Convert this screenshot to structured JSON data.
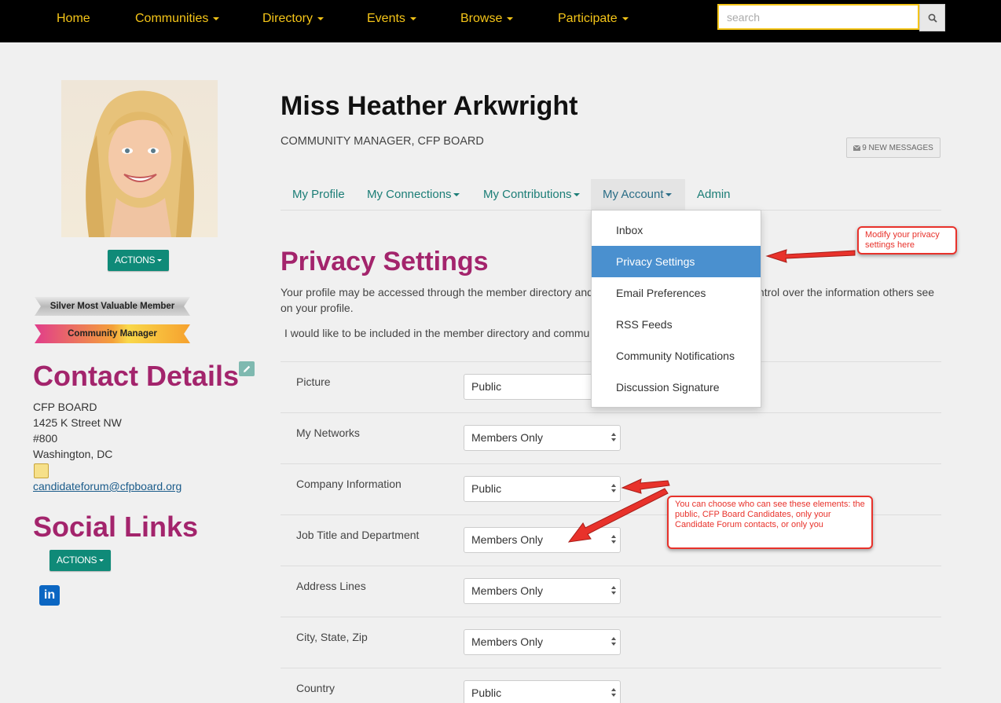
{
  "nav": {
    "items": [
      {
        "label": "Home",
        "has_caret": false
      },
      {
        "label": "Communities",
        "has_caret": true
      },
      {
        "label": "Directory",
        "has_caret": true
      },
      {
        "label": "Events",
        "has_caret": true
      },
      {
        "label": "Browse",
        "has_caret": true
      },
      {
        "label": "Participate",
        "has_caret": true
      }
    ],
    "search_placeholder": "search",
    "accent": "#f5c518"
  },
  "sidebar": {
    "actions_label": "ACTIONS",
    "badges": [
      "Silver Most Valuable Member",
      "Community Manager"
    ],
    "contact_heading": "Contact Details",
    "contact_lines": [
      "CFP BOARD",
      "1425 K Street NW",
      "#800",
      "Washington, DC"
    ],
    "email": "candidateforum@cfpboard.org",
    "social_heading": "Social Links",
    "social_actions_label": "ACTIONS",
    "linkedin_label": "in"
  },
  "profile": {
    "name": "Miss Heather Arkwright",
    "title": "COMMUNITY MANAGER, CFP BOARD",
    "messages_label": "9 NEW MESSAGES"
  },
  "tabs": [
    {
      "label": "My Profile",
      "has_caret": false
    },
    {
      "label": "My Connections",
      "has_caret": true
    },
    {
      "label": "My Contributions",
      "has_caret": true
    },
    {
      "label": "My Account",
      "has_caret": true
    },
    {
      "label": "Admin",
      "has_caret": false
    }
  ],
  "account_menu": [
    "Inbox",
    "Privacy Settings",
    "Email Preferences",
    "RSS Feeds",
    "Community Notifications",
    "Discussion Signature"
  ],
  "privacy": {
    "heading": "Privacy Settings",
    "intro_part1": "Your profile may be accessed through the member directory and",
    "intro_part2": "ntrol over the information others see",
    "intro_part3": "on your profile.",
    "include_text": "I would like to be included in the member directory and commu",
    "rows": [
      {
        "label": "Picture",
        "value": "Public"
      },
      {
        "label": "My Networks",
        "value": "Members Only"
      },
      {
        "label": "Company Information",
        "value": "Public"
      },
      {
        "label": "Job Title and Department",
        "value": "Members Only"
      },
      {
        "label": "Address Lines",
        "value": "Members Only"
      },
      {
        "label": "City, State, Zip",
        "value": "Members Only"
      },
      {
        "label": "Country",
        "value": "Public"
      }
    ]
  },
  "callouts": {
    "privacy_note": "Modify your privacy settings here",
    "visibility_note": "You can choose who can see these elements: the public, CFP Board Candidates, only your Candidate Forum contacts, or only you"
  },
  "colors": {
    "heading": "#a3246c",
    "teal": "#0f8a78",
    "link": "#1b7d76",
    "callout": "#e8322b"
  }
}
